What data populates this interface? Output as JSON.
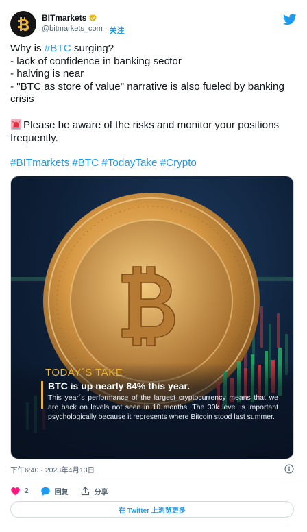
{
  "author": {
    "name": "BITmarkets",
    "handle": "@bitmarkets_com",
    "separator": "·",
    "follow_label": "关注"
  },
  "tweet": {
    "line1_pre": "Why is ",
    "line1_tag": "#BTC",
    "line1_post": " surging?",
    "line2": "- lack of confidence in banking sector",
    "line3": "- halving is near",
    "line4": "- \"BTC as store of value\" narrative is also fueled by banking crisis",
    "warning": "Please be aware of the risks and monitor your positions frequently.",
    "hashtags": [
      "#BITmarkets",
      "#BTC",
      "#TodayTake",
      "#Crypto"
    ]
  },
  "media": {
    "label": "TODAY´S TAKE",
    "headline": "BTC is up nearly 84% this year.",
    "body": "This year´s performance of the largest cryptocurrency means that we are back on levels not seen in 10 months. The 30k level is important psychologically because it represents where Bitcoin stood last summer."
  },
  "timestamp": "下午6:40 · 2023年4月13日",
  "actions": {
    "likes": "2",
    "reply_label": "回复",
    "share_label": "分享"
  },
  "read_more": "在 Twitter 上浏览更多",
  "colors": {
    "accent": "#1d9bf0",
    "like": "#f91880",
    "gold": "#e8b23b"
  },
  "icons": [
    "bitmarkets-logo",
    "verified-badge-icon",
    "twitter-bird-icon",
    "siren-icon",
    "info-icon",
    "heart-icon",
    "reply-icon",
    "share-icon"
  ]
}
